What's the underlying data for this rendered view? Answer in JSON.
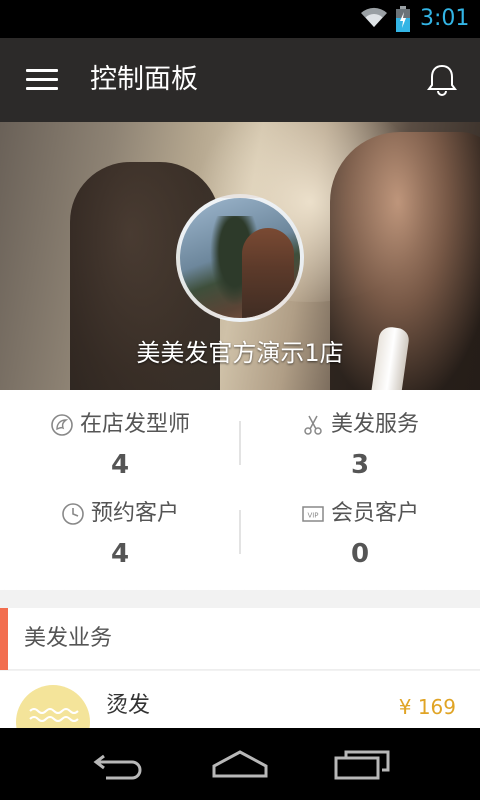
{
  "status_bar": {
    "time": "3:01",
    "icons": [
      "wifi-icon",
      "battery-icon"
    ]
  },
  "app_bar": {
    "title": "控制面板",
    "menu_icon": "menu-icon",
    "notification_icon": "bell-icon"
  },
  "hero": {
    "store_name": "美美发官方演示1店",
    "avatar_icon": "store-avatar"
  },
  "stats": [
    {
      "icon": "stylist-icon",
      "label": "在店发型师",
      "value": "4"
    },
    {
      "icon": "scissors-icon",
      "label": "美发服务",
      "value": "3"
    },
    {
      "icon": "clock-icon",
      "label": "预约客户",
      "value": "4"
    },
    {
      "icon": "vip-icon",
      "label": "会员客户",
      "value": "0"
    }
  ],
  "section": {
    "title": "美发业务"
  },
  "services": [
    {
      "name": "烫发",
      "price": "¥ 169",
      "icon": "perm-icon"
    }
  ],
  "nav_bar": {
    "buttons": [
      "back-icon",
      "home-icon",
      "recent-apps-icon"
    ]
  },
  "colors": {
    "accent": "#f26e4f",
    "price": "#e0a425",
    "status_time": "#33b5e5",
    "app_bar": "#2c2a29"
  }
}
